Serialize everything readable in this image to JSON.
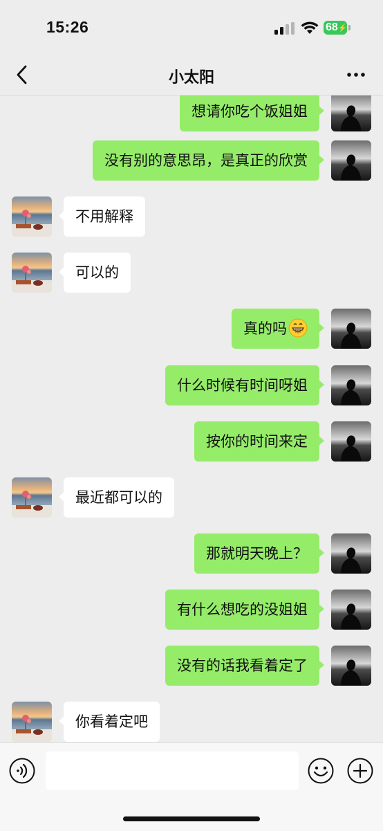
{
  "status_bar": {
    "time": "15:26",
    "battery": "68"
  },
  "chat_header": {
    "title": "小太阳"
  },
  "messages": [
    {
      "side": "out",
      "text": "想请你吃个饭姐姐"
    },
    {
      "side": "out",
      "text": "没有别的意思昂，是真正的欣赏"
    },
    {
      "side": "in",
      "text": "不用解释"
    },
    {
      "side": "in",
      "text": "可以的"
    },
    {
      "side": "out",
      "text": "真的吗",
      "emoji": "grinning-face-icon"
    },
    {
      "side": "out",
      "text": "什么时候有时间呀姐"
    },
    {
      "side": "out",
      "text": "按你的时间来定"
    },
    {
      "side": "in",
      "text": "最近都可以的"
    },
    {
      "side": "out",
      "text": "那就明天晚上？"
    },
    {
      "side": "out",
      "text": "有什么想吃的没姐姐"
    },
    {
      "side": "out",
      "text": "没有的话我看着定了"
    },
    {
      "side": "in",
      "text": "你看着定吧"
    }
  ],
  "input_bar": {
    "value": ""
  },
  "colors": {
    "outgoing_bubble": "#95ec69",
    "incoming_bubble": "#ffffff",
    "background": "#ededed"
  }
}
